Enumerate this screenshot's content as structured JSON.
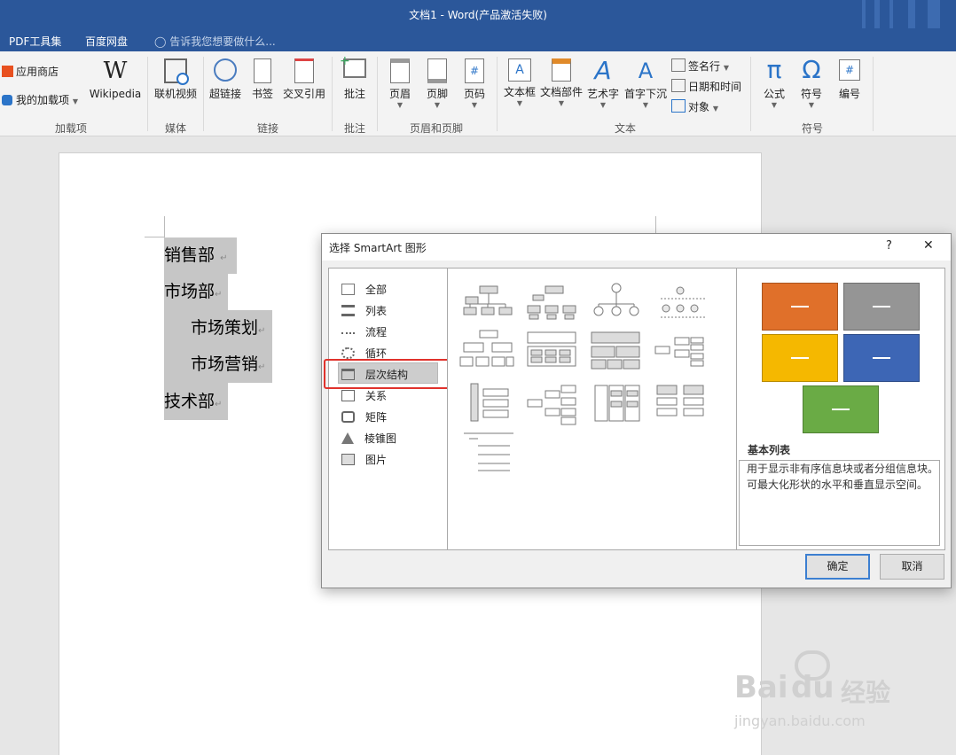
{
  "window": {
    "title": "文档1 - Word(产品激活失败)"
  },
  "tabs": [
    "PDF工具集",
    "百度网盘"
  ],
  "tellme_placeholder": "告诉我您想要做什么...",
  "ribbon": {
    "addins": {
      "store": "应用商店",
      "my_addins": "我的加载项",
      "wikipedia": "Wikipedia",
      "group": "加载项"
    },
    "media": {
      "online_video": "联机视频",
      "group": "媒体"
    },
    "links": {
      "hyperlink": "超链接",
      "bookmark": "书签",
      "cross_ref": "交叉引用",
      "group": "链接"
    },
    "comments": {
      "comment": "批注",
      "group": "批注"
    },
    "header_footer": {
      "header": "页眉",
      "footer": "页脚",
      "page_number": "页码",
      "group": "页眉和页脚"
    },
    "text": {
      "textbox": "文本框",
      "quick_parts": "文档部件",
      "wordart": "艺术字",
      "dropcap": "首字下沉",
      "signature": "签名行",
      "datetime": "日期和时间",
      "object": "对象",
      "group": "文本"
    },
    "symbols": {
      "equation": "公式",
      "symbol": "符号",
      "numbering": "编号",
      "group": "符号"
    }
  },
  "document": {
    "lines": [
      "销售部",
      "市场部",
      "市场策划",
      "市场营销",
      "技术部"
    ],
    "para_mark": "↵"
  },
  "dialog": {
    "title": "选择 SmartArt 图形",
    "help": "?",
    "close": "✕",
    "categories": [
      "全部",
      "列表",
      "流程",
      "循环",
      "层次结构",
      "关系",
      "矩阵",
      "棱锥图",
      "图片"
    ],
    "selected_category": "层次结构",
    "preview_title": "基本列表",
    "preview_desc": "用于显示非有序信息块或者分组信息块。可最大化形状的水平和垂直显示空间。",
    "ok": "确定",
    "cancel": "取消",
    "swatch_colors": [
      "#e0702a",
      "#959595",
      "#f5b800",
      "#3d66b5",
      "#6aab45"
    ]
  },
  "watermark": {
    "brand": "Bai",
    "brand2": "du",
    "site_cn": "经验",
    "url": "jingyan.baidu.com"
  }
}
